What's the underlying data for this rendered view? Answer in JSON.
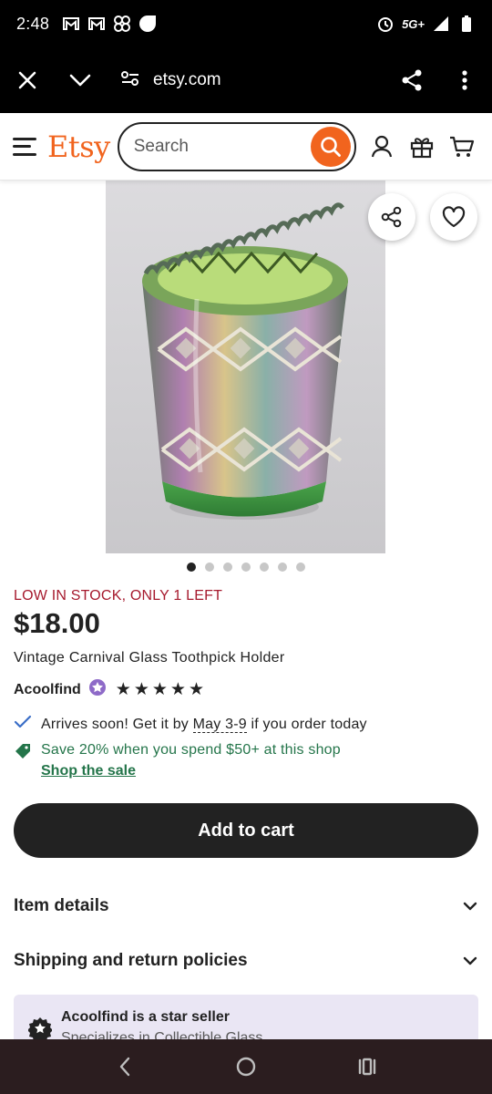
{
  "status_bar": {
    "time": "2:48",
    "network": "5G+"
  },
  "browser": {
    "url": "etsy.com"
  },
  "header": {
    "logo": "Etsy",
    "search_placeholder": "Search"
  },
  "gallery": {
    "image_count": 7,
    "active_index": 0
  },
  "product": {
    "stock_notice": "LOW IN STOCK, ONLY 1 LEFT",
    "price": "$18.00",
    "title": "Vintage Carnival Glass Toothpick Holder",
    "seller": "Acoolfind",
    "rating_stars": 5
  },
  "shipping": {
    "prefix": "Arrives soon! Get it by",
    "dates": "May 3-9",
    "suffix": "if you order today"
  },
  "promo": {
    "text": "Save 20% when you spend $50+ at this shop",
    "link": "Shop the sale"
  },
  "actions": {
    "add_to_cart": "Add to cart"
  },
  "sections": {
    "item_details": "Item details",
    "shipping_policies": "Shipping and return policies"
  },
  "star_seller": {
    "title": "Acoolfind is a star seller",
    "subtitle": "Specializes in Collectible Glass"
  },
  "colors": {
    "brand_orange": "#f1641e",
    "stock_red": "#a61a2e",
    "promo_green": "#24754a",
    "star_seller_bg": "#eae6f4"
  }
}
